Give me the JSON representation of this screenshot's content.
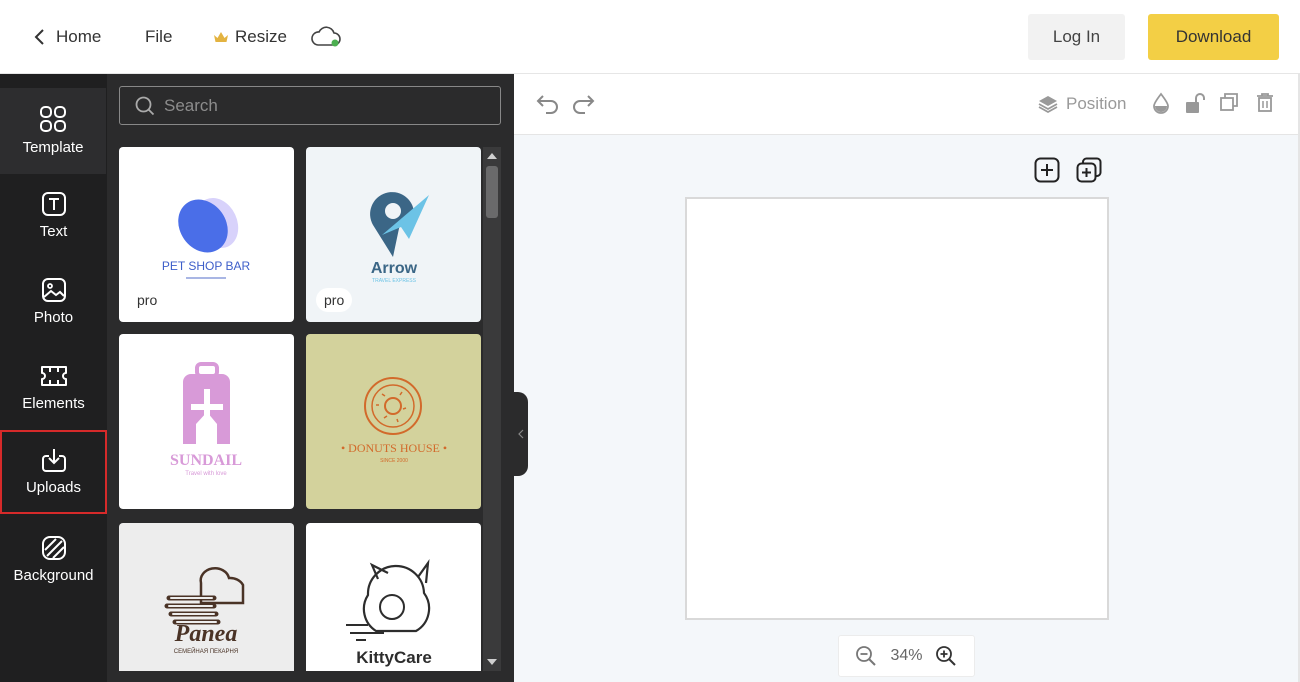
{
  "header": {
    "home_label": "Home",
    "file_label": "File",
    "resize_label": "Resize",
    "login_label": "Log In",
    "download_label": "Download"
  },
  "sidebar": {
    "items": [
      {
        "label": "Template",
        "icon": "template-grid-icon"
      },
      {
        "label": "Text",
        "icon": "text-icon"
      },
      {
        "label": "Photo",
        "icon": "photo-icon"
      },
      {
        "label": "Elements",
        "icon": "elements-icon"
      },
      {
        "label": "Uploads",
        "icon": "upload-icon"
      },
      {
        "label": "Background",
        "icon": "background-icon"
      }
    ],
    "active": "Template",
    "highlighted": "Uploads"
  },
  "panel": {
    "search_placeholder": "Search",
    "templates": [
      {
        "title": "PET SHOP BAR",
        "subtitle": "",
        "badge": "pro",
        "bg": "#ffffff"
      },
      {
        "title": "Arrow",
        "subtitle": "TRAVEL EXPRESS",
        "badge": "pro",
        "bg": "#f0f4f7"
      },
      {
        "title": "SUNDAIL",
        "subtitle": "Travel with love",
        "badge": "",
        "bg": "#ffffff"
      },
      {
        "title": "• DONUTS HOUSE •",
        "subtitle": "SINCE 2000",
        "badge": "",
        "bg": "#d3d29c"
      },
      {
        "title": "Panea",
        "subtitle": "СЕМЕЙНАЯ ПЕКАРНЯ",
        "badge": "",
        "bg": "#ededed"
      },
      {
        "title": "KittyCare",
        "subtitle": "",
        "badge": "",
        "bg": "#ffffff"
      }
    ]
  },
  "toolbar": {
    "position_label": "Position"
  },
  "canvas": {
    "zoom_label": "34%"
  },
  "colors": {
    "accent": "#f3cf45",
    "sidebar_bg": "#1f1f20",
    "panel_bg": "#2b2b2c",
    "highlight": "#d62a2a"
  }
}
